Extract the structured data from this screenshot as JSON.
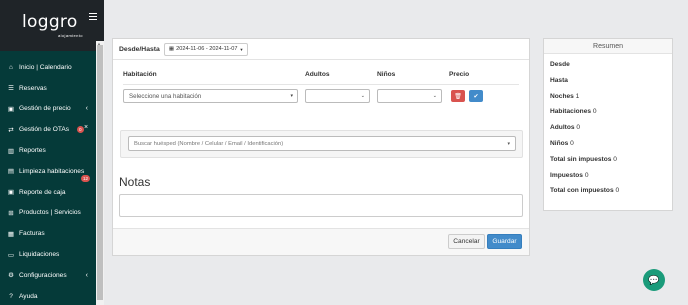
{
  "brand": {
    "logo": "loggro",
    "logo_sub": "alojamiento",
    "accent": "#053a39"
  },
  "sidebar": {
    "items": [
      {
        "label": "Inicio | Calendario",
        "icon": "home-icon"
      },
      {
        "label": "Reservas",
        "icon": "list-icon"
      },
      {
        "label": "Gestión de precio",
        "icon": "price-tag-icon",
        "has_chevron": true
      },
      {
        "label": "Gestión de OTAs",
        "icon": "exchange-icon",
        "badge": "0",
        "has_close": true
      },
      {
        "label": "Reportes",
        "icon": "bar-chart-icon"
      },
      {
        "label": "Limpieza habitaciones",
        "icon": "broom-icon",
        "badge": "12"
      },
      {
        "label": "Reporte de caja",
        "icon": "cash-icon"
      },
      {
        "label": "Productos | Servicios",
        "icon": "cart-icon"
      },
      {
        "label": "Facturas",
        "icon": "invoice-icon"
      },
      {
        "label": "Liquidaciones",
        "icon": "settlement-icon"
      },
      {
        "label": "Configuraciones",
        "icon": "gear-icon",
        "has_chevron": true
      },
      {
        "label": "Ayuda",
        "icon": "help-icon"
      }
    ]
  },
  "form": {
    "date_label": "Desde/Hasta",
    "date_range": "2024-11-06 - 2024-11-07",
    "columns": {
      "room": "Habitación",
      "adults": "Adultos",
      "children": "Niños",
      "price": "Precio"
    },
    "room_placeholder": "Seleccione una habitación",
    "guest_placeholder": "Buscar huésped (Nombre / Celular / Email / Identificación)",
    "notes_title": "Notas",
    "cancel_label": "Cancelar",
    "save_label": "Guardar"
  },
  "summary": {
    "title": "Resumen",
    "rows": [
      {
        "label": "Desde",
        "value": ""
      },
      {
        "label": "Hasta",
        "value": ""
      },
      {
        "label": "Noches",
        "value": "1"
      },
      {
        "label": "Habitaciones",
        "value": "0"
      },
      {
        "label": "Adultos",
        "value": "0"
      },
      {
        "label": "Niños",
        "value": "0"
      },
      {
        "label": "Total sin impuestos",
        "value": "0"
      },
      {
        "label": "Impuestos",
        "value": "0"
      },
      {
        "label": "Total con impuestos",
        "value": "0"
      }
    ]
  },
  "colors": {
    "delete": "#d9534f",
    "confirm": "#428bca",
    "chat": "#1a9b7a"
  }
}
